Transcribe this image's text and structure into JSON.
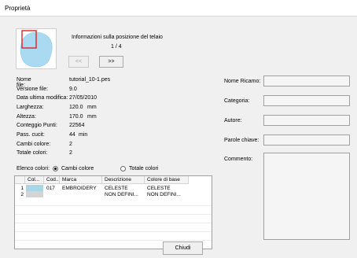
{
  "window": {
    "title": "Proprietà"
  },
  "frame_info": {
    "label": "Informazioni sulla posizione del telaio",
    "position": "1 / 4",
    "prev_label": "<<",
    "next_label": ">>"
  },
  "file_info": {
    "rows": [
      {
        "label": "Nome file:",
        "value": "tutorial_10-1.pes",
        "unit": ""
      },
      {
        "label": "Versione file:",
        "value": "9.0",
        "unit": ""
      },
      {
        "label": "Data ultima modifica:",
        "value": "27/05/2010",
        "unit": ""
      },
      {
        "label": "Larghezza:",
        "value": "120.0",
        "unit": "mm"
      },
      {
        "label": "Altezza:",
        "value": "170.0",
        "unit": "mm"
      },
      {
        "label": "Conteggio Punti:",
        "value": "22564",
        "unit": ""
      },
      {
        "label": "Pass. cucit:",
        "value": "44",
        "unit": "min"
      },
      {
        "label": "Cambi colore:",
        "value": "2",
        "unit": ""
      },
      {
        "label": "Totale colori:",
        "value": "2",
        "unit": ""
      }
    ]
  },
  "color_list": {
    "label": "Elenco colori:",
    "option_changes": "Cambi colore",
    "option_total": "Totale colori",
    "selected": "Cambi colore",
    "columns": [
      "Col...",
      "Cod...",
      "Marca",
      "Descrizione",
      "Colore di base"
    ],
    "rows": [
      {
        "index": "1",
        "swatch": "#a8d8e8",
        "code": "017",
        "brand": "EMBROIDERY",
        "description": "CELESTE",
        "base": "CELESTE"
      },
      {
        "index": "2",
        "swatch": "#d4d4d4",
        "code": "",
        "brand": "",
        "description": "NON DEFINI...",
        "base": "NON DEFINI..."
      }
    ]
  },
  "meta_fields": {
    "design_name_label": "Nome Ricamo:",
    "category_label": "Categoria:",
    "author_label": "Autore:",
    "keywords_label": "Parole chiave:",
    "comment_label": "Commento:"
  },
  "footer": {
    "close_label": "Chiudi"
  },
  "colors": {
    "preview_fill": "#a9daf2",
    "preview_frame": "#e0201e"
  }
}
